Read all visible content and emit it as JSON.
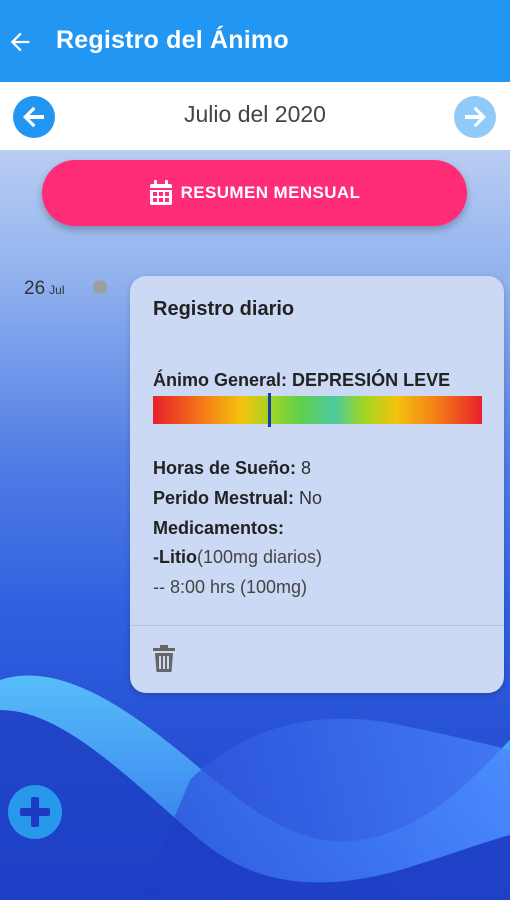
{
  "header": {
    "title": "Registro del Ánimo",
    "back_icon": "arrow-left-icon"
  },
  "month_nav": {
    "label": "Julio del 2020",
    "prev_icon": "arrow-left-circle-icon",
    "next_icon": "arrow-right-circle-icon"
  },
  "summary_button": {
    "label": "RESUMEN MENSUAL",
    "icon": "calendar-icon",
    "color": "#ff2d78"
  },
  "entry": {
    "day": "26",
    "month": "Jul",
    "card": {
      "title": "Registro diario",
      "mood_label": "Ánimo General:",
      "mood_value": "DEPRESIÓN LEVE",
      "mood_level": 0.35,
      "sleep_label": "Horas de Sueño:",
      "sleep_value": "8",
      "period_label": "Perido Mestrual:",
      "period_value": "No",
      "meds_label": "Medicamentos:",
      "med_name": "-Litio",
      "med_dose": "(100mg diarios)",
      "med_schedule": "-- 8:00 hrs (100mg)",
      "delete_icon": "trash-icon"
    }
  },
  "fab": {
    "icon": "plus-icon"
  },
  "colors": {
    "primary": "#2196f3",
    "accent": "#ff2d78"
  }
}
